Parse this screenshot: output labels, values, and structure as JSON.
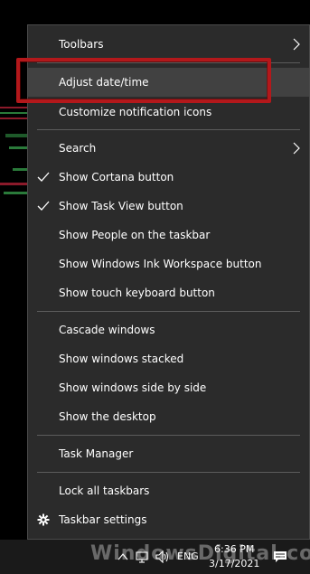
{
  "menu": {
    "items": [
      {
        "label": "Toolbars",
        "submenu": true
      },
      {
        "label": "Adjust date/time",
        "hovered": true
      },
      {
        "label": "Customize notification icons"
      },
      {
        "label": "Search",
        "submenu": true
      },
      {
        "label": "Show Cortana button",
        "checked": true
      },
      {
        "label": "Show Task View button",
        "checked": true
      },
      {
        "label": "Show People on the taskbar"
      },
      {
        "label": "Show Windows Ink Workspace button"
      },
      {
        "label": "Show touch keyboard button"
      },
      {
        "label": "Cascade windows"
      },
      {
        "label": "Show windows stacked"
      },
      {
        "label": "Show windows side by side"
      },
      {
        "label": "Show the desktop"
      },
      {
        "label": "Task Manager"
      },
      {
        "label": "Lock all taskbars"
      },
      {
        "label": "Taskbar settings",
        "icon": "gear-icon"
      }
    ]
  },
  "taskbar": {
    "language": "ENG",
    "time": "6:36 PM",
    "date": "3/17/2021",
    "tray_icons": [
      "chevron-up-icon",
      "network-icon",
      "volume-icon",
      "action-center-icon"
    ]
  },
  "watermark": {
    "text": "WindowsDigital.com"
  },
  "colors": {
    "menu_bg": "#2b2b2b",
    "hover_bg": "#414141",
    "highlight": "#b3181b",
    "text": "#ffffff"
  }
}
